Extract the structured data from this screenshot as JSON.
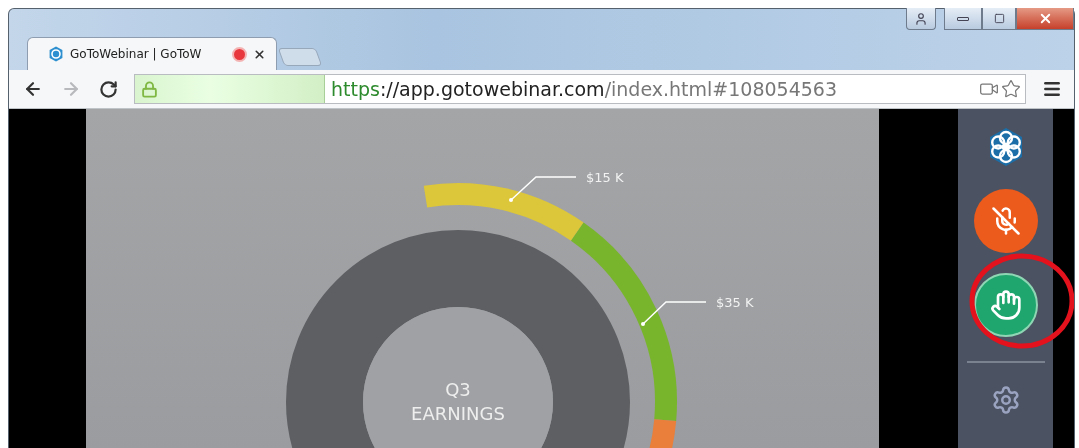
{
  "browser": {
    "tab": {
      "title": "GoToWebinar | GoToW",
      "recording": true,
      "selected": true
    },
    "address": {
      "secure": true,
      "parts": [
        {
          "kind": "scheme",
          "text": "https"
        },
        {
          "kind": "host",
          "text": "://app.gotowebinar.com"
        },
        {
          "kind": "path",
          "text": "/index.html#108054563"
        }
      ]
    }
  },
  "slide": {
    "title_lines": [
      "Q3",
      "EARNINGS"
    ],
    "segments": [
      {
        "label": "$15 K",
        "color": "#dcc63a"
      },
      {
        "label": "$35 K",
        "color": "#79b52c"
      },
      {
        "color": "#e97f3a"
      }
    ]
  },
  "sidebar": {
    "controls": [
      {
        "kind": "logo"
      },
      {
        "kind": "microphone",
        "muted": true
      },
      {
        "kind": "raise_hand",
        "highlighted": true
      },
      {
        "kind": "divider"
      },
      {
        "kind": "settings"
      }
    ]
  }
}
